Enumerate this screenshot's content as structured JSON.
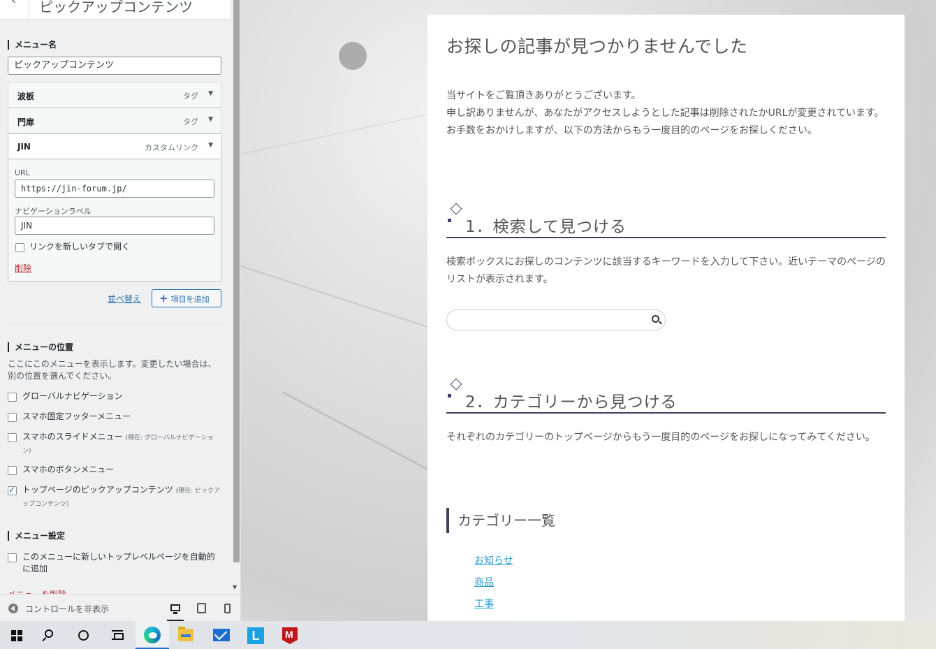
{
  "panel": {
    "header_title": "ピックアップコンテンツ",
    "menu_name_label": "メニュー名",
    "menu_name_value": "ピックアップコンテンツ",
    "items": [
      {
        "name": "波板",
        "type": "タグ"
      },
      {
        "name": "門扉",
        "type": "タグ"
      },
      {
        "name": "JIN",
        "type": "カスタムリンク"
      }
    ],
    "open_item": {
      "url_label": "URL",
      "url_value": "https://jin-forum.jp/",
      "nav_label_label": "ナビゲーションラベル",
      "nav_label_value": "JIN",
      "new_tab_label": "リンクを新しいタブで開く",
      "new_tab_checked": false,
      "delete_label": "削除"
    },
    "reorder_label": "並べ替え",
    "add_item_label": "項目を追加",
    "location_title": "メニューの位置",
    "location_desc": "ここにこのメニューを表示します。変更したい場合は、別の位置を選んでください。",
    "locations": [
      {
        "label": "グローバルナビゲーション",
        "note": "",
        "checked": false
      },
      {
        "label": "スマホ固定フッターメニュー",
        "note": "",
        "checked": false
      },
      {
        "label": "スマホのスライドメニュー",
        "note": "(現在: グローバルナビゲーション)",
        "checked": false
      },
      {
        "label": "スマホのボタンメニュー",
        "note": "",
        "checked": false
      },
      {
        "label": "トップページのピックアップコンテンツ",
        "note": "(現在: ピックアップコンテンツ)",
        "checked": true
      }
    ],
    "settings_title": "メニュー設定",
    "auto_add_label": "このメニューに新しいトップレベルページを自動的に追加",
    "delete_menu_label": "メニューを削除",
    "hide_controls_label": "コントロールを非表示"
  },
  "preview": {
    "title": "お探しの記事が見つかりませんでした",
    "intro_line1": "当サイトをご覧頂きありがとうございます。",
    "intro_line2": "申し訳ありませんが、あなたがアクセスしようとした記事は削除されたかURLが変更されています。お手数をおかけしますが、以下の方法からもう一度目的のページをお探しください。",
    "section1_heading": "1．検索して見つける",
    "section1_text": "検索ボックスにお探しのコンテンツに該当するキーワードを入力して下さい。近いテーマのページのリストが表示されます。",
    "section2_heading": "2．カテゴリーから見つける",
    "section2_text": "それぞれのカテゴリーのトップページからもう一度目的のページをお探しになってみてください。",
    "category_list_title": "カテゴリー一覧",
    "categories": [
      "お知らせ",
      "商品",
      "工事"
    ]
  },
  "taskbar": {
    "apps": [
      "start-icon",
      "search-icon",
      "cortana-icon",
      "task-view-icon",
      "edge-icon",
      "file-explorer-icon",
      "mail-icon",
      "line-icon",
      "mcafee-icon"
    ]
  },
  "colors": {
    "accent": "#2271b1",
    "heading_navy": "#3c4060",
    "link": "#2a9fd0",
    "danger": "#b32d2e"
  }
}
